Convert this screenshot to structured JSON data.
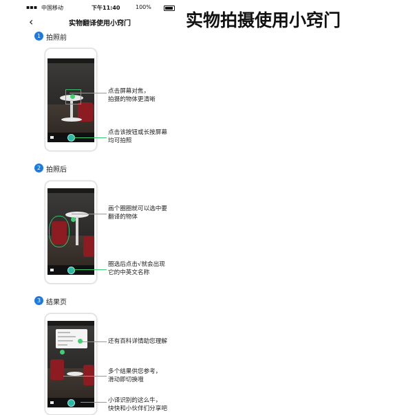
{
  "status_bar": {
    "carrier": "中国移动",
    "time": "下午11:40",
    "battery": "100%"
  },
  "nav": {
    "back_icon": "chevron-left-icon",
    "title": "实物翻译使用小窍门"
  },
  "heading": "实物拍摄使用小窍门",
  "steps": [
    {
      "number": "1",
      "label": "拍照前",
      "annotations": [
        "点击屏幕对焦，",
        "拍摄的物体更清晰",
        "点击该按钮或长按屏幕",
        "均可拍照"
      ]
    },
    {
      "number": "2",
      "label": "拍照后",
      "annotations": [
        "画个圈圈就可以选中要",
        "翻译的物体",
        "圈选后点击√就会出现",
        "它的中英文名称"
      ]
    },
    {
      "number": "3",
      "label": "结果页",
      "annotations": [
        "还有百科详情助您理解",
        "多个结果供您参考，",
        "滑动即切换哦",
        "小译识别的这么牛，",
        "快快和小伙伴们分享吧"
      ]
    }
  ],
  "colors": {
    "accent": "#1f7ae0",
    "highlight_green": "#3ecb73",
    "stool_red": "#8d1b22"
  }
}
